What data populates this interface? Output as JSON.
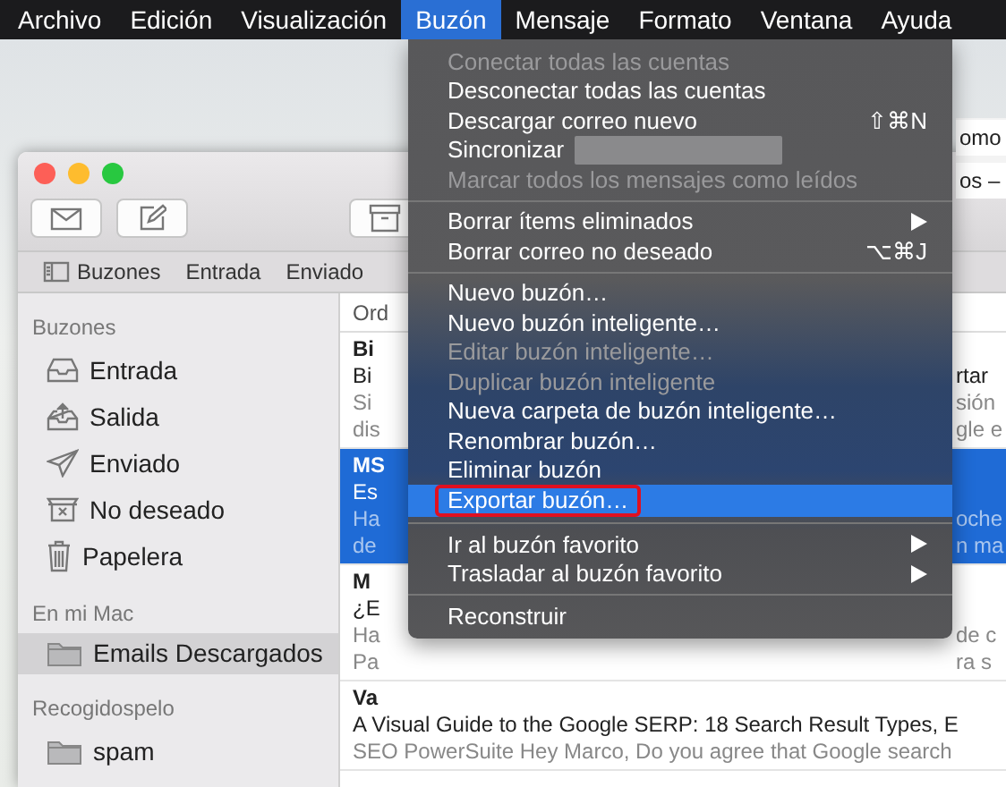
{
  "menu_bar": {
    "items": [
      {
        "label": "Archivo",
        "selected": false
      },
      {
        "label": "Edición",
        "selected": false
      },
      {
        "label": "Visualización",
        "selected": false
      },
      {
        "label": "Buzón",
        "selected": true
      },
      {
        "label": "Mensaje",
        "selected": false
      },
      {
        "label": "Formato",
        "selected": false
      },
      {
        "label": "Ventana",
        "selected": false
      },
      {
        "label": "Ayuda",
        "selected": false
      }
    ]
  },
  "background_window": {
    "texts": [
      "omo",
      "os –"
    ]
  },
  "mail_window": {
    "toolbar": {
      "buttons": [
        {
          "kind": "envelope"
        },
        {
          "kind": "compose"
        },
        {
          "kind": "archive"
        }
      ]
    },
    "favorites_bar": [
      "Buzones",
      "Entrada",
      "Enviado"
    ],
    "sidebar": {
      "sections": [
        {
          "title": "Buzones",
          "items": [
            {
              "label": "Entrada",
              "kind": "inbox",
              "selected": false
            },
            {
              "label": "Salida",
              "kind": "outbox",
              "selected": false
            },
            {
              "label": "Enviado",
              "kind": "sent",
              "selected": false
            },
            {
              "label": "No deseado",
              "kind": "junk",
              "selected": false
            },
            {
              "label": "Papelera",
              "kind": "trash",
              "selected": false
            }
          ]
        },
        {
          "title": "En mi Mac",
          "items": [
            {
              "label": "Emails Descargados",
              "kind": "folder",
              "selected": true
            }
          ]
        },
        {
          "title": "Recogidospelo",
          "items": [
            {
              "label": "spam",
              "kind": "folder",
              "selected": false
            }
          ]
        }
      ]
    },
    "message_list": {
      "header": "Ord",
      "messages": [
        {
          "selected": false,
          "lines": [
            {
              "text": "Bi"
            },
            {
              "text": "Bi",
              "tail": "rtar"
            },
            {
              "text": "Si",
              "tail": "sión"
            },
            {
              "text": "dis",
              "tail": "gle e"
            }
          ]
        },
        {
          "selected": true,
          "lines": [
            {
              "text": "MS"
            },
            {
              "text": "Es"
            },
            {
              "text": "Ha",
              "tail": "oche"
            },
            {
              "text": "de",
              "tail": "n ma"
            }
          ]
        },
        {
          "selected": false,
          "lines": [
            {
              "text": "M"
            },
            {
              "text": "¿E"
            },
            {
              "text": "Ha",
              "tail": "de c"
            },
            {
              "text": "Pa",
              "tail": "ra s"
            }
          ]
        },
        {
          "selected": false,
          "lines": [
            {
              "text": "Va"
            },
            {
              "text": "A Visual Guide to the Google SERP: 18 Search Result Types, E"
            },
            {
              "text": "SEO PowerSuite Hey Marco, Do you agree that Google search"
            }
          ]
        }
      ]
    }
  },
  "menu": {
    "items": [
      {
        "kind": "item",
        "label": "Conectar todas las cuentas",
        "enabled": false
      },
      {
        "kind": "item",
        "label": "Desconectar todas las cuentas",
        "enabled": true
      },
      {
        "kind": "item",
        "label": "Descargar correo nuevo",
        "enabled": true,
        "shortcut": "⇧⌘N"
      },
      {
        "kind": "item",
        "label": "Sincronizar",
        "enabled": true,
        "redacted": true
      },
      {
        "kind": "item",
        "label": "Marcar todos los mensajes como leídos",
        "enabled": false
      },
      {
        "kind": "separator"
      },
      {
        "kind": "item",
        "label": "Borrar ítems eliminados",
        "enabled": true,
        "submenu": true
      },
      {
        "kind": "item",
        "label": "Borrar correo no deseado",
        "enabled": true,
        "shortcut": "⌥⌘J"
      },
      {
        "kind": "separator"
      },
      {
        "kind": "item",
        "label": "Nuevo buzón…",
        "enabled": true
      },
      {
        "kind": "item",
        "label": "Nuevo buzón inteligente…",
        "enabled": true
      },
      {
        "kind": "item",
        "label": "Editar buzón inteligente…",
        "enabled": false
      },
      {
        "kind": "item",
        "label": "Duplicar buzón inteligente",
        "enabled": false
      },
      {
        "kind": "item",
        "label": "Nueva carpeta de buzón inteligente…",
        "enabled": true
      },
      {
        "kind": "item",
        "label": "Renombrar buzón…",
        "enabled": true
      },
      {
        "kind": "item",
        "label": "Eliminar buzón",
        "enabled": true
      },
      {
        "kind": "item",
        "label": "Exportar buzón…",
        "enabled": true,
        "highlighted": true,
        "annotated": true
      },
      {
        "kind": "separator"
      },
      {
        "kind": "item",
        "label": "Ir al buzón favorito",
        "enabled": true,
        "submenu": true
      },
      {
        "kind": "item",
        "label": "Trasladar al buzón favorito",
        "enabled": true,
        "submenu": true
      },
      {
        "kind": "separator"
      },
      {
        "kind": "item",
        "label": "Reconstruir",
        "enabled": true
      }
    ]
  }
}
